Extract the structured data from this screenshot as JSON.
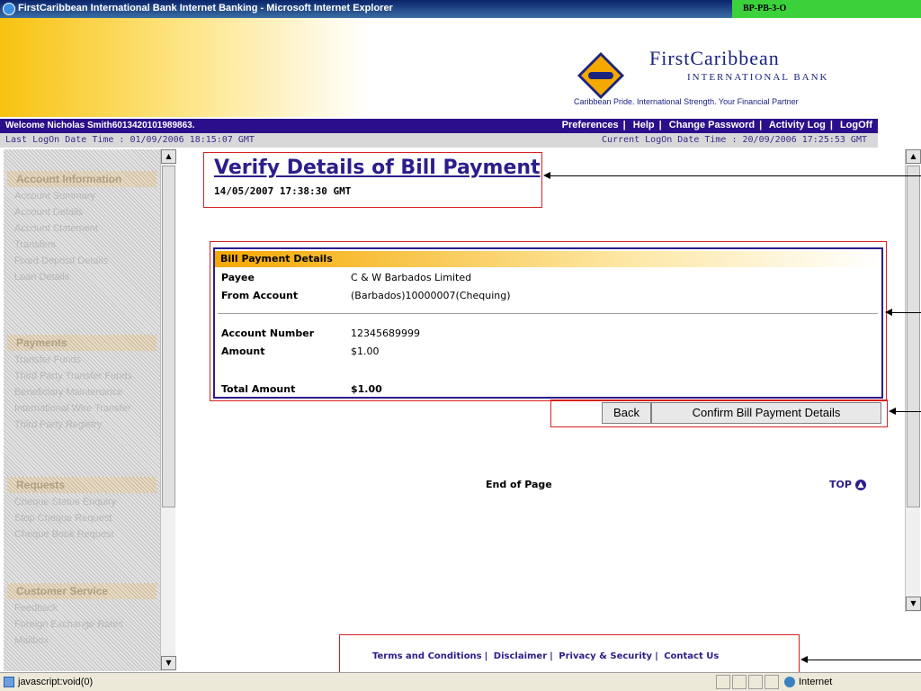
{
  "window": {
    "title": "FirstCaribbean International Bank Internet Banking - Microsoft Internet Explorer",
    "page_id": "BP-PB-3-O"
  },
  "brand": {
    "name": "FirstCaribbean",
    "subtitle": "INTERNATIONAL BANK",
    "tagline": "Caribbean Pride. International Strength. Your Financial Partner"
  },
  "nav": {
    "welcome": "Welcome Nicholas Smith6013420101989863.",
    "links": [
      "Preferences",
      "Help",
      "Change Password",
      "Activity Log",
      "LogOff"
    ],
    "last_logon": "Last LogOn Date Time : 01/09/2006 18:15:07 GMT",
    "current_logon": "Current LogOn Date Time : 20/09/2006 17:25:53 GMT"
  },
  "left_menu": {
    "sections": [
      {
        "title": "Account Information",
        "items": [
          "Account Summary",
          "Account Details",
          "Account Statement",
          "Transfers",
          "Fixed Deposit Details",
          "Loan Details"
        ]
      },
      {
        "title": "Payments",
        "items": [
          "Transfer Funds",
          "Third Party Transfer Funds",
          "Beneficiary Maintenance",
          "International Wire Transfer",
          "Third Party Registry"
        ]
      },
      {
        "title": "Requests",
        "items": [
          "Cheque Status Enquiry",
          "Stop Cheque Request",
          "Cheque Book Request"
        ]
      },
      {
        "title": "Customer Service",
        "items": [
          "Feedback",
          "Foreign Exchange Rates",
          "Mailbox"
        ]
      }
    ]
  },
  "main": {
    "title": "Verify Details of Bill Payment",
    "timestamp": "14/05/2007 17:38:30 GMT",
    "details": {
      "header": "Bill Payment Details",
      "payee_label": "Payee",
      "payee_value": "C & W Barbados Limited",
      "from_label": "From Account",
      "from_value": "(Barbados)10000007(Chequing)",
      "account_number_label": "Account Number",
      "account_number_value": "12345689999",
      "amount_label": "Amount",
      "amount_value": "$1.00",
      "total_label": "Total Amount",
      "total_value": "$1.00"
    },
    "buttons": {
      "back": "Back",
      "confirm": "Confirm Bill Payment Details"
    },
    "end_of_page": "End of Page",
    "top": "TOP"
  },
  "footer": {
    "links": [
      "Terms and Conditions",
      "Disclaimer",
      "Privacy & Security",
      "Contact Us"
    ]
  },
  "status": {
    "text": "javascript:void(0)",
    "zone": "Internet"
  },
  "colors": {
    "accent_navy": "#2b1e8a",
    "accent_gold": "#f5a800",
    "annotation_red": "#d82020",
    "page_id_green": "#3bd13b"
  }
}
